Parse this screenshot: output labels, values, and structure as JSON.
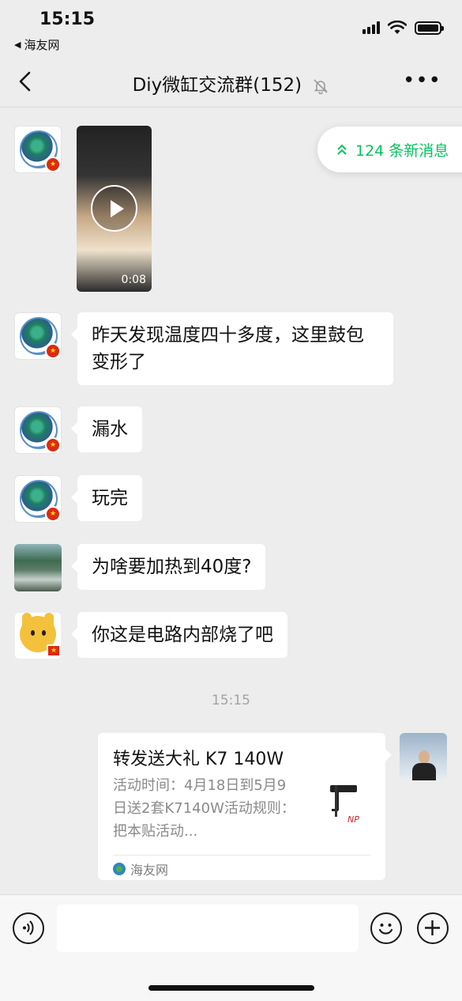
{
  "status_bar": {
    "time": "15:15",
    "back_app": "海友网"
  },
  "nav": {
    "title": "Diy微缸交流群(152)"
  },
  "new_messages_pill": "124 条新消息",
  "messages": [
    {
      "type": "video",
      "duration": "0:08"
    },
    {
      "type": "text",
      "text": "昨天发现温度四十多度，这里鼓包变形了"
    },
    {
      "type": "text",
      "text": "漏水"
    },
    {
      "type": "text",
      "text": "玩完"
    },
    {
      "type": "text",
      "text": "为啥要加热到40度?"
    },
    {
      "type": "text",
      "text": "你这是电路内部烧了吧"
    }
  ],
  "time_divider": "15:15",
  "share_card": {
    "title": "转发送大礼 K7 140W",
    "description": "活动时间：4月18日到5月9日送2套K7140W活动规则：把本贴活动...",
    "source": "海友网"
  },
  "colors": {
    "accent_green": "#07c160",
    "background": "#ededed"
  }
}
